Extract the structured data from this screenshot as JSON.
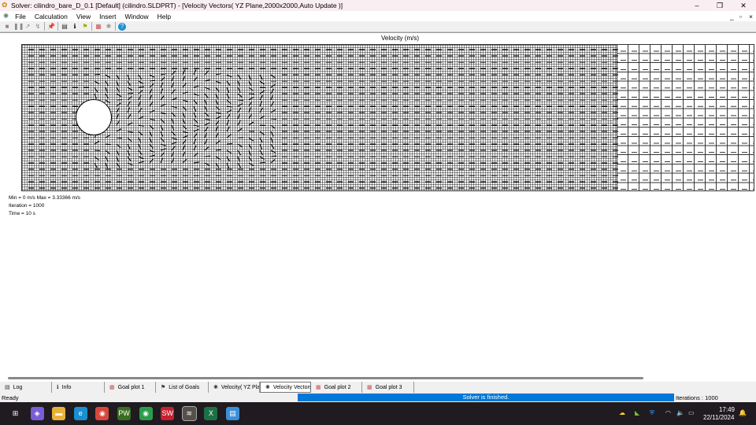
{
  "window": {
    "title": "Solver: cilindro_bare_D_0.1 [Default] (cilindro.SLDPRT) - [Velocity Vectors( YZ Plane,2000x2000,Auto Update )]",
    "minimize": "–",
    "restore": "❐",
    "close": "✕"
  },
  "menu": [
    "File",
    "Calculation",
    "View",
    "Insert",
    "Window",
    "Help"
  ],
  "mdi": {
    "minimize": "_",
    "restore": "▫",
    "close": "×"
  },
  "toolbar": [
    {
      "icon": "stop-icon",
      "g": "■"
    },
    {
      "icon": "pause-icon",
      "g": "❚❚"
    },
    {
      "icon": "insert-icon",
      "g": "↗"
    },
    {
      "icon": "refresh-icon",
      "g": "↯"
    },
    {
      "icon": "pin-icon",
      "g": "📌"
    },
    {
      "icon": "log-icon",
      "g": "▤"
    },
    {
      "icon": "info-icon",
      "g": "ℹ"
    },
    {
      "icon": "goals-flag-icon",
      "g": "⚑"
    },
    {
      "icon": "goal-plot-icon",
      "g": "▦"
    },
    {
      "icon": "preview-icon",
      "g": "✱"
    },
    {
      "icon": "help-icon",
      "g": "?"
    }
  ],
  "plot": {
    "title": "Velocity (m/s)",
    "min_max": "Min = 0 m/s   Max = 3.33366 m/s",
    "iteration": "Iteration = 1000",
    "time": "Time = 10 s"
  },
  "tabs": [
    {
      "label": "Log",
      "icon": "log-icon",
      "g": "▤"
    },
    {
      "label": "Info",
      "icon": "info-icon",
      "g": "ℹ"
    },
    {
      "label": "Goal plot 1",
      "icon": "goal-plot-icon",
      "g": "▦"
    },
    {
      "label": "List of Goals",
      "icon": "goals-flag-icon",
      "g": "⚑"
    },
    {
      "label": "Velocity( YZ Pla",
      "icon": "velocity-icon",
      "g": "✺"
    },
    {
      "label": "Velocity Vectors",
      "icon": "velocity-icon",
      "g": "✺",
      "active": true
    },
    {
      "label": "Goal plot 2",
      "icon": "goal-plot-icon",
      "g": "▦"
    },
    {
      "label": "Goal plot 3",
      "icon": "goal-plot-icon",
      "g": "▦"
    }
  ],
  "status": {
    "left": "Ready",
    "progress_text": "Solver is finished.",
    "progress_percent": 100,
    "iterations": "Iterations : 1000"
  },
  "taskbar": {
    "time": "17:49",
    "date": "22/11/2024",
    "apps": [
      {
        "name": "start",
        "g": "⊞",
        "c": "#1f1b20"
      },
      {
        "name": "copilot",
        "g": "◈",
        "c": "#7a5cd6"
      },
      {
        "name": "file-explorer",
        "g": "▬",
        "c": "#e8b23a"
      },
      {
        "name": "edge",
        "g": "e",
        "c": "#1a8fd1"
      },
      {
        "name": "chrome",
        "g": "◉",
        "c": "#d9463b"
      },
      {
        "name": "app-pw",
        "g": "PW",
        "c": "#3a6d1f"
      },
      {
        "name": "chrome-profile",
        "g": "◉",
        "c": "#2a9d4c"
      },
      {
        "name": "solidworks",
        "g": "SW",
        "c": "#c8202f"
      },
      {
        "name": "flow-simulation",
        "g": "≋",
        "c": "#55504a"
      },
      {
        "name": "excel",
        "g": "X",
        "c": "#1d7044"
      },
      {
        "name": "notepad",
        "g": "▤",
        "c": "#3b8fd6"
      }
    ]
  },
  "colors": {
    "progress": "#0078d7",
    "taskbar": "#1f1b20",
    "titlebar": "#f9eef2"
  }
}
